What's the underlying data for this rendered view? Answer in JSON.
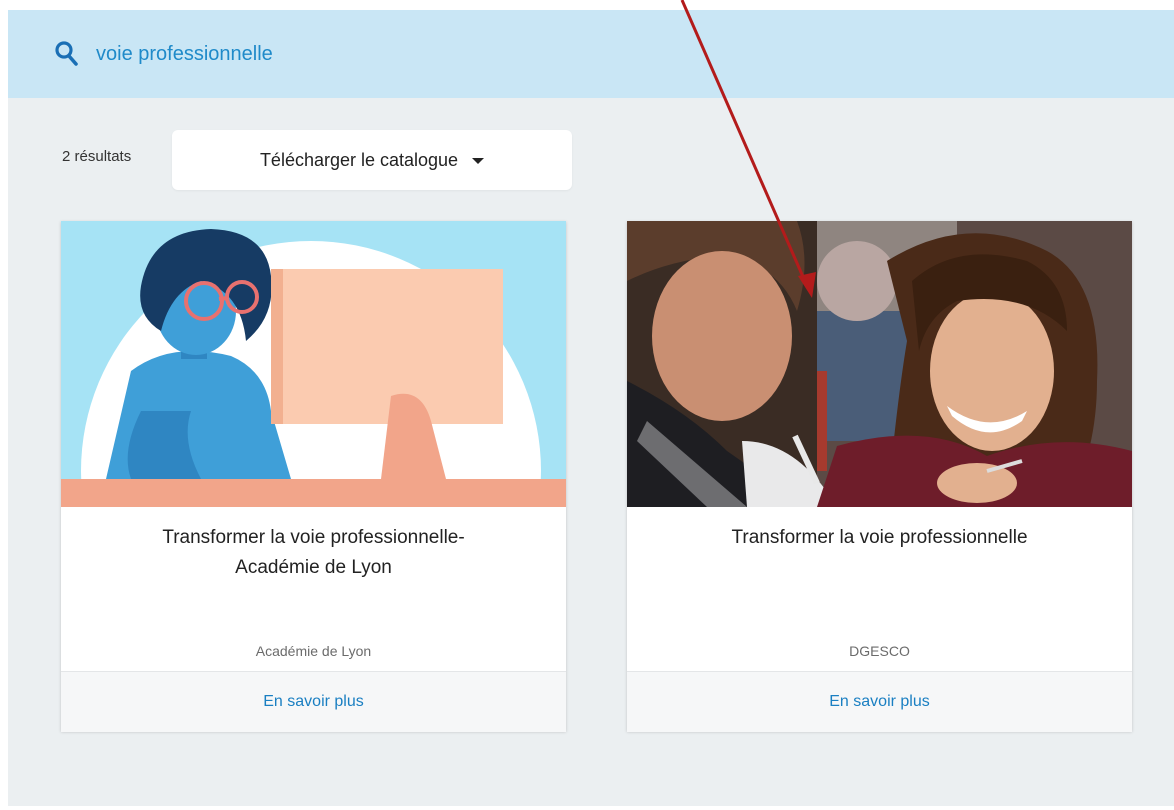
{
  "search": {
    "query": "voie professionnelle",
    "icon": "search-icon",
    "accent": "#1f8ac9"
  },
  "results": {
    "count_label": "2 résultats",
    "catalog_button_label": "Télécharger le catalogue"
  },
  "cards": [
    {
      "title_line1": "Transformer la voie professionnelle-",
      "title_line2": "Académie de Lyon",
      "source": "Académie de Lyon",
      "link_label": "En savoir plus"
    },
    {
      "title_line1": "Transformer la voie professionnelle",
      "title_line2": "",
      "source": "DGESCO",
      "link_label": "En savoir plus"
    }
  ],
  "colors": {
    "search_bar_bg": "#c9e6f5",
    "page_bg": "#ebeff1",
    "link": "#1a7fc2",
    "arrow": "#b31b1b"
  }
}
